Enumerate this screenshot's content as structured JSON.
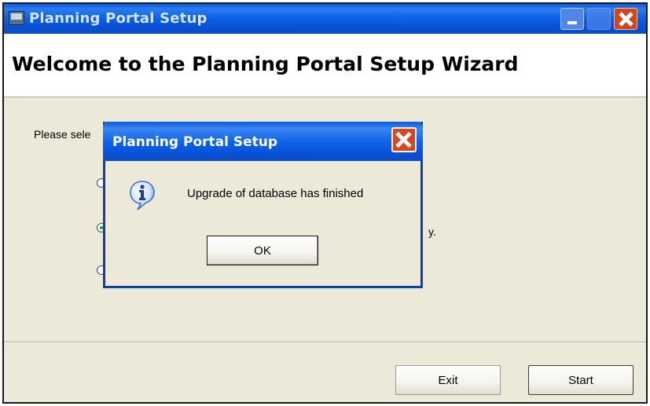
{
  "window": {
    "title": "Planning Portal Setup",
    "header_title": "Welcome to the Planning Portal Setup Wizard",
    "instruction_text": "Please sele",
    "partial_text": "y."
  },
  "buttons": {
    "exit_label": "Exit",
    "start_label": "Start"
  },
  "dialog": {
    "title": "Planning Portal Setup",
    "message": "Upgrade of database has finished",
    "ok_label": "OK",
    "icon": "info-icon"
  },
  "colors": {
    "titlebar": "#0b5fe6",
    "close_button": "#d2461c",
    "window_bg": "#ece9d8"
  }
}
